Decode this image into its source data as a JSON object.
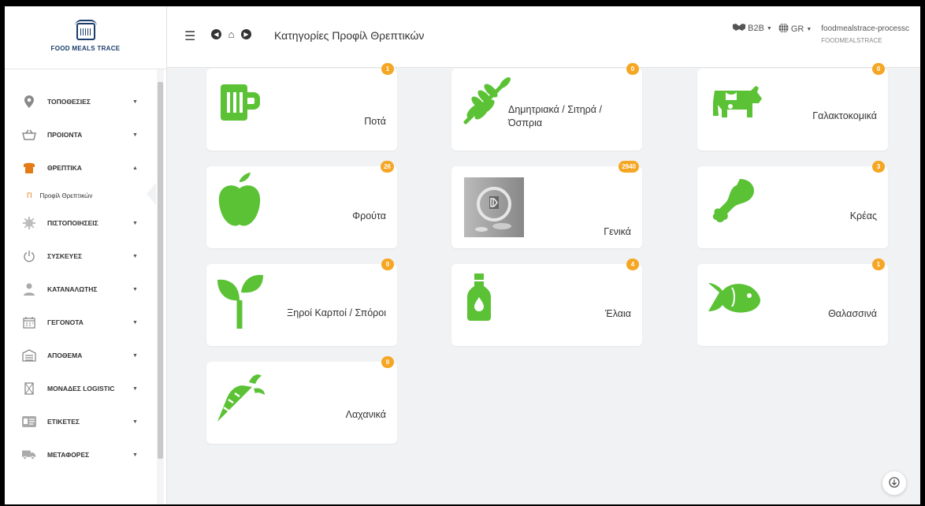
{
  "app": {
    "logo_text": "FOOD MEALS TRACE"
  },
  "topbar": {
    "title": "Κατηγορίες Προφίλ Θρεπτικών",
    "b2b_label": "B2B",
    "lang_label": "GR",
    "user_name": "foodmealstrace-processc",
    "user_org": "FOODMEALSTRACE"
  },
  "sidebar": {
    "items": [
      {
        "label": "ΤΟΠΟΘΕΣΙΕΣ",
        "icon": "map-pin-icon",
        "chev": "▼"
      },
      {
        "label": "ΠΡΟΙΟΝΤΑ",
        "icon": "basket-icon",
        "chev": "▼"
      },
      {
        "label": "ΘΡΕΠΤΙΚΑ",
        "icon": "nutrition-icon",
        "chev": "▲",
        "active": true
      },
      {
        "label": "ΠΙΣΤΟΠΟΙΗΣΕΙΣ",
        "icon": "certificate-icon",
        "chev": "▼"
      },
      {
        "label": "ΣΥΣΚΕΥΕΣ",
        "icon": "power-icon",
        "chev": "▼"
      },
      {
        "label": "ΚΑΤΑΝΑΛΩΤΗΣ",
        "icon": "user-icon",
        "chev": "▼"
      },
      {
        "label": "ΓΕΓΟΝΟΤΑ",
        "icon": "calendar-icon",
        "chev": "▼"
      },
      {
        "label": "ΑΠΟΘΕΜΑ",
        "icon": "warehouse-icon",
        "chev": "▼"
      },
      {
        "label": "ΜΟΝΑΔΕΣ LOGISTIC",
        "icon": "hourglass-icon",
        "chev": "▼"
      },
      {
        "label": "ΕΤΙΚΕΤΕΣ",
        "icon": "id-card-icon",
        "chev": "▼"
      },
      {
        "label": "ΜΕΤΑΦΟΡΕΣ",
        "icon": "truck-icon",
        "chev": "▼"
      }
    ],
    "submenu": {
      "bullet": "Π",
      "label": "Προφίλ Θρεπτικών"
    }
  },
  "cards": [
    {
      "label": "Ποτά",
      "count": "1",
      "icon": "mug-icon"
    },
    {
      "label": "Δημητριακά / Σιτηρά / Όσπρια",
      "count": "0",
      "icon": "wheat-icon"
    },
    {
      "label": "Γαλακτοκομικά",
      "count": "0",
      "icon": "cow-icon"
    },
    {
      "label": "Φρούτα",
      "count": "26",
      "icon": "apple-icon"
    },
    {
      "label": "Γενικά",
      "count": "2940",
      "icon": "general-image-icon"
    },
    {
      "label": "Κρέας",
      "count": "3",
      "icon": "drumstick-icon"
    },
    {
      "label": "Ξηροί Καρποί / Σπόροι",
      "count": "0",
      "icon": "sprout-icon"
    },
    {
      "label": "Έλαια",
      "count": "4",
      "icon": "oil-bottle-icon"
    },
    {
      "label": "Θαλασσινά",
      "count": "1",
      "icon": "fish-icon"
    },
    {
      "label": "Λαχανικά",
      "count": "0",
      "icon": "carrot-icon"
    }
  ],
  "colors": {
    "accent": "#e37b16",
    "icon_green": "#5bc236",
    "badge": "#f5a623"
  }
}
